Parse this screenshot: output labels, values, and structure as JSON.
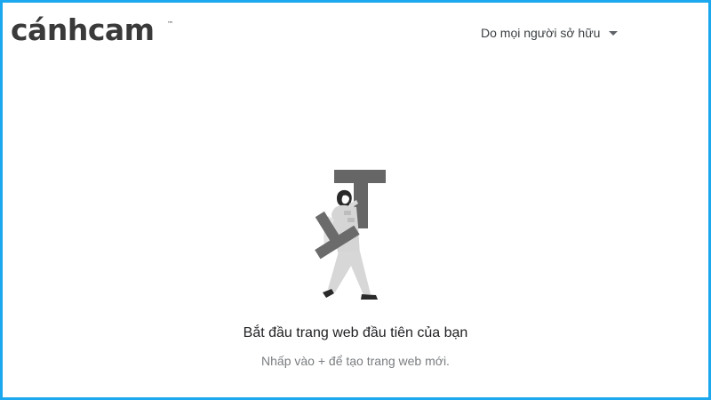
{
  "header": {
    "logo_text": "cánhcam",
    "logo_tm": "™",
    "owner_filter_label": "Do mọi người sở hữu",
    "owner_filter_icon": "caret-down-icon"
  },
  "empty_state": {
    "illustration": "person-carrying-letter-t-illustration",
    "title": "Bắt đầu trang web đầu tiên của bạn",
    "subtitle": "Nhấp vào + để tạo trang web mới."
  },
  "colors": {
    "frame_border": "#1ba8ee",
    "logo": "#3a3a3a",
    "title": "#202124",
    "subtitle": "#7a7d80"
  }
}
